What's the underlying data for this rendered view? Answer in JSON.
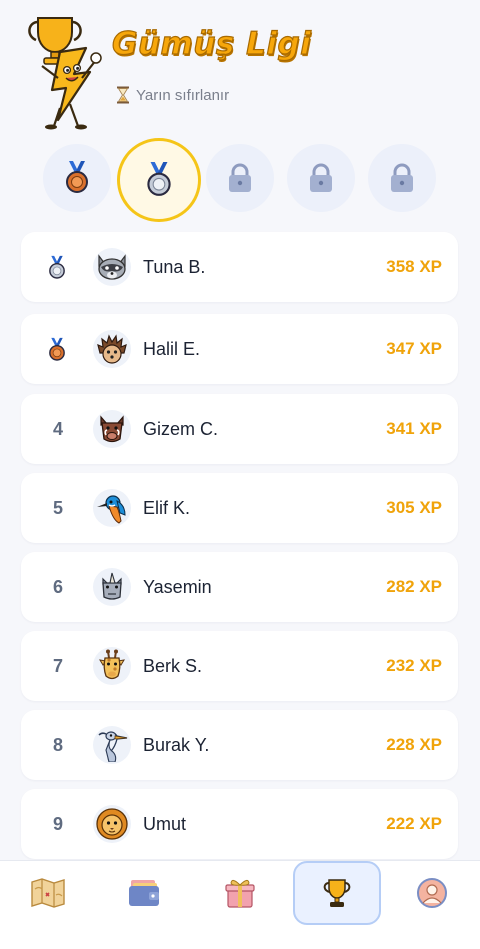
{
  "header": {
    "title": "Gümüş Ligi",
    "reset_text": "Yarın sıfırlanır",
    "mascot_icon": "trophy-mascot-icon",
    "hourglass_icon": "hourglass-icon"
  },
  "leagues": [
    {
      "icon": "bronze-medal-icon",
      "state": "unlocked"
    },
    {
      "icon": "silver-medal-icon",
      "state": "current"
    },
    {
      "icon": "lock-icon",
      "state": "locked"
    },
    {
      "icon": "lock-icon",
      "state": "locked"
    },
    {
      "icon": "lock-icon",
      "state": "locked"
    }
  ],
  "leaderboard": [
    {
      "rank": "",
      "medal": "silver-medal-icon",
      "avatar": "raccoon-avatar",
      "name": "Tuna B.",
      "xp": "358 XP"
    },
    {
      "rank": "",
      "medal": "bronze-medal-icon",
      "avatar": "hedgehog-avatar",
      "name": "Halil E.",
      "xp": "347 XP"
    },
    {
      "rank": "4",
      "avatar": "boar-avatar",
      "name": "Gizem C.",
      "xp": "341 XP"
    },
    {
      "rank": "5",
      "avatar": "kingfisher-avatar",
      "name": "Elif K.",
      "xp": "305 XP"
    },
    {
      "rank": "6",
      "avatar": "rhino-avatar",
      "name": "Yasemin",
      "xp": "282 XP"
    },
    {
      "rank": "7",
      "avatar": "giraffe-avatar",
      "name": "Berk S.",
      "xp": "232 XP"
    },
    {
      "rank": "8",
      "avatar": "heron-avatar",
      "name": "Burak Y.",
      "xp": "228 XP"
    },
    {
      "rank": "9",
      "avatar": "lion-avatar",
      "name": "Umut",
      "xp": "222 XP"
    }
  ],
  "tabbar": {
    "tabs": [
      {
        "icon": "map-icon"
      },
      {
        "icon": "wallet-icon"
      },
      {
        "icon": "gift-icon"
      },
      {
        "icon": "trophy-icon",
        "active": true
      },
      {
        "icon": "profile-icon"
      }
    ]
  },
  "colors": {
    "accent": "#f0a30a",
    "active_ring": "#f5c518",
    "active_tab_bg": "#eaf1ff"
  }
}
